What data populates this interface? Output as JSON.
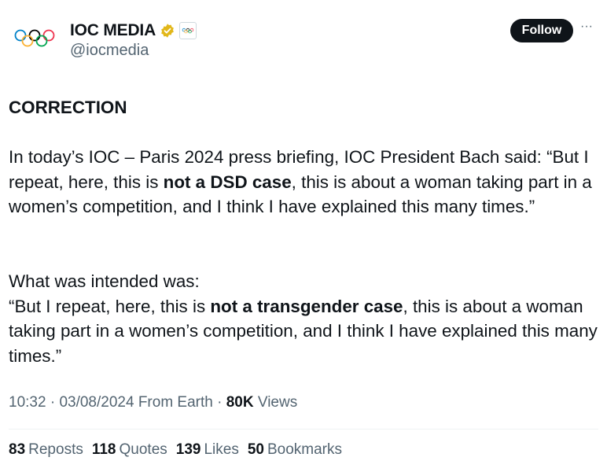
{
  "account": {
    "display_name": "IOC MEDIA",
    "handle": "@iocmedia",
    "avatar_icon": "olympic-rings-icon",
    "verified_icon": "verified-gold-badge-icon",
    "affiliate_icon": "olympic-rings-badge-icon",
    "verified_color": "#E2B719"
  },
  "actions": {
    "follow_label": "Follow",
    "more_icon": "more-horizontal-icon",
    "more_label": "···"
  },
  "tweet": {
    "heading": "CORRECTION",
    "p1_a": "In today’s IOC – Paris 2024 press briefing, IOC President Bach said: “But I repeat, here, this is ",
    "p1_bold": "not a DSD case",
    "p1_b": ", this is about a woman taking part in a women’s competition, and I think I have explained this many times.”",
    "p2_intro": "What was intended was:",
    "p2_a": "“But I repeat, here, this is ",
    "p2_bold": "not a transgender case",
    "p2_b": ", this is about a woman taking part in a women’s competition, and I think I have explained this many times.”"
  },
  "meta": {
    "time": "10:32",
    "date": "03/08/2024",
    "source": "From Earth",
    "views_count": "80K",
    "views_label": "Views",
    "sep": "·"
  },
  "stats": [
    {
      "count": "83",
      "label": "Reposts"
    },
    {
      "count": "118",
      "label": "Quotes"
    },
    {
      "count": "139",
      "label": "Likes"
    },
    {
      "count": "50",
      "label": "Bookmarks"
    }
  ],
  "colors": {
    "text": "#0f1419",
    "secondary": "#536471",
    "button_bg": "#0f1419",
    "ring_blue": "#0081C8",
    "ring_yellow": "#FCB131",
    "ring_black": "#000000",
    "ring_green": "#00A651",
    "ring_red": "#EE334E"
  }
}
